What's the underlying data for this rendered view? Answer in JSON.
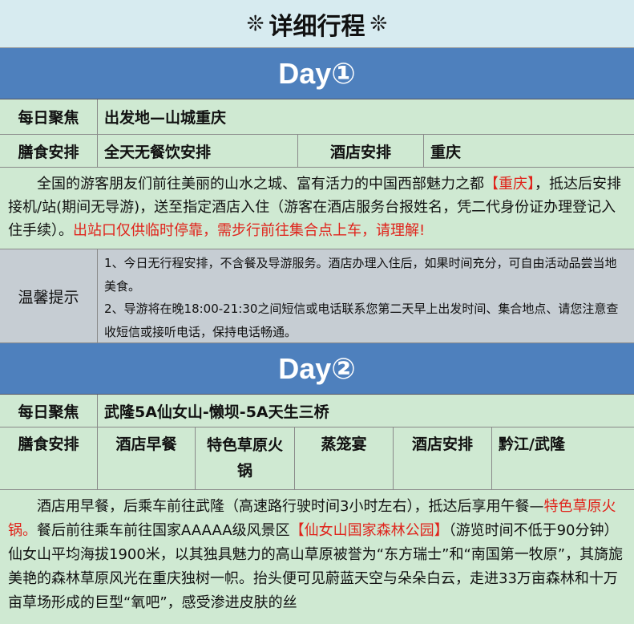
{
  "header": {
    "ornament": "❊",
    "title": "详细行程"
  },
  "day1": {
    "title": "Day①",
    "focus_label": "每日聚焦",
    "focus_value": "出发地—山城重庆",
    "meal_label": "膳食安排",
    "meal_value": "全天无餐饮安排",
    "hotel_label": "酒店安排",
    "hotel_value": "重庆",
    "desc_parts": [
      "全国的游客朋友们前往美丽的山水之城、富有活力的中国西部魅力之都",
      "【重庆】",
      "，抵达后安排接机/站(期间无导游)，送至指定酒店入住（游客在酒店服务台报姓名，凭二代身份证办理登记入住手续）。",
      "出站口仅供临时停靠，需步行前往集合点上车，请理解!"
    ],
    "tips_label": "温馨提示",
    "tips": [
      "1、今日无行程安排，不含餐及导游服务。酒店办理入住后，如果时间充分，可自由活动品尝当地美食。",
      "2、导游将在晚18:00-21:30之间短信或电话联系您第二天早上出发时间、集合地点、请您注意查收短信或接听电话，保持电话畅通。"
    ]
  },
  "day2": {
    "title": "Day②",
    "focus_label": "每日聚焦",
    "focus_value": "武隆5A仙女山-懒坝-5A天生三桥",
    "meal_label": "膳食安排",
    "meal_breakfast": "酒店早餐",
    "meal_lunch": "特色草原火锅",
    "meal_dinner": "蒸笼宴",
    "hotel_label": "酒店安排",
    "hotel_value": "黔江/武隆",
    "desc_parts": [
      "酒店用早餐，后乘车前往武隆（高速路行驶时间3小时左右），抵达后享用午餐—",
      "特色草原火锅。",
      "餐后前往乘车前往国家AAAAA级风景区",
      "【仙女山国家森林公园】",
      "（游览时间不低于90分钟）仙女山平均海拔1900米，以其独具魅力的高山草原被誉为“东方瑞士”和“南国第一牧原”，其旖旎美艳的森林草原风光在重庆独树一帜。抬头便可见蔚蓝天空与朵朵白云，走进33万亩森林和十万亩草场形成的巨型“氧吧”，感受渗进皮肤的丝"
    ]
  },
  "colors": {
    "bg": "#cfe9d2",
    "day_bar": "#4e80bd",
    "tip_bg": "#c6cdd3",
    "accent_red": "#e0231b",
    "title_bg": "#d7ebf0"
  }
}
